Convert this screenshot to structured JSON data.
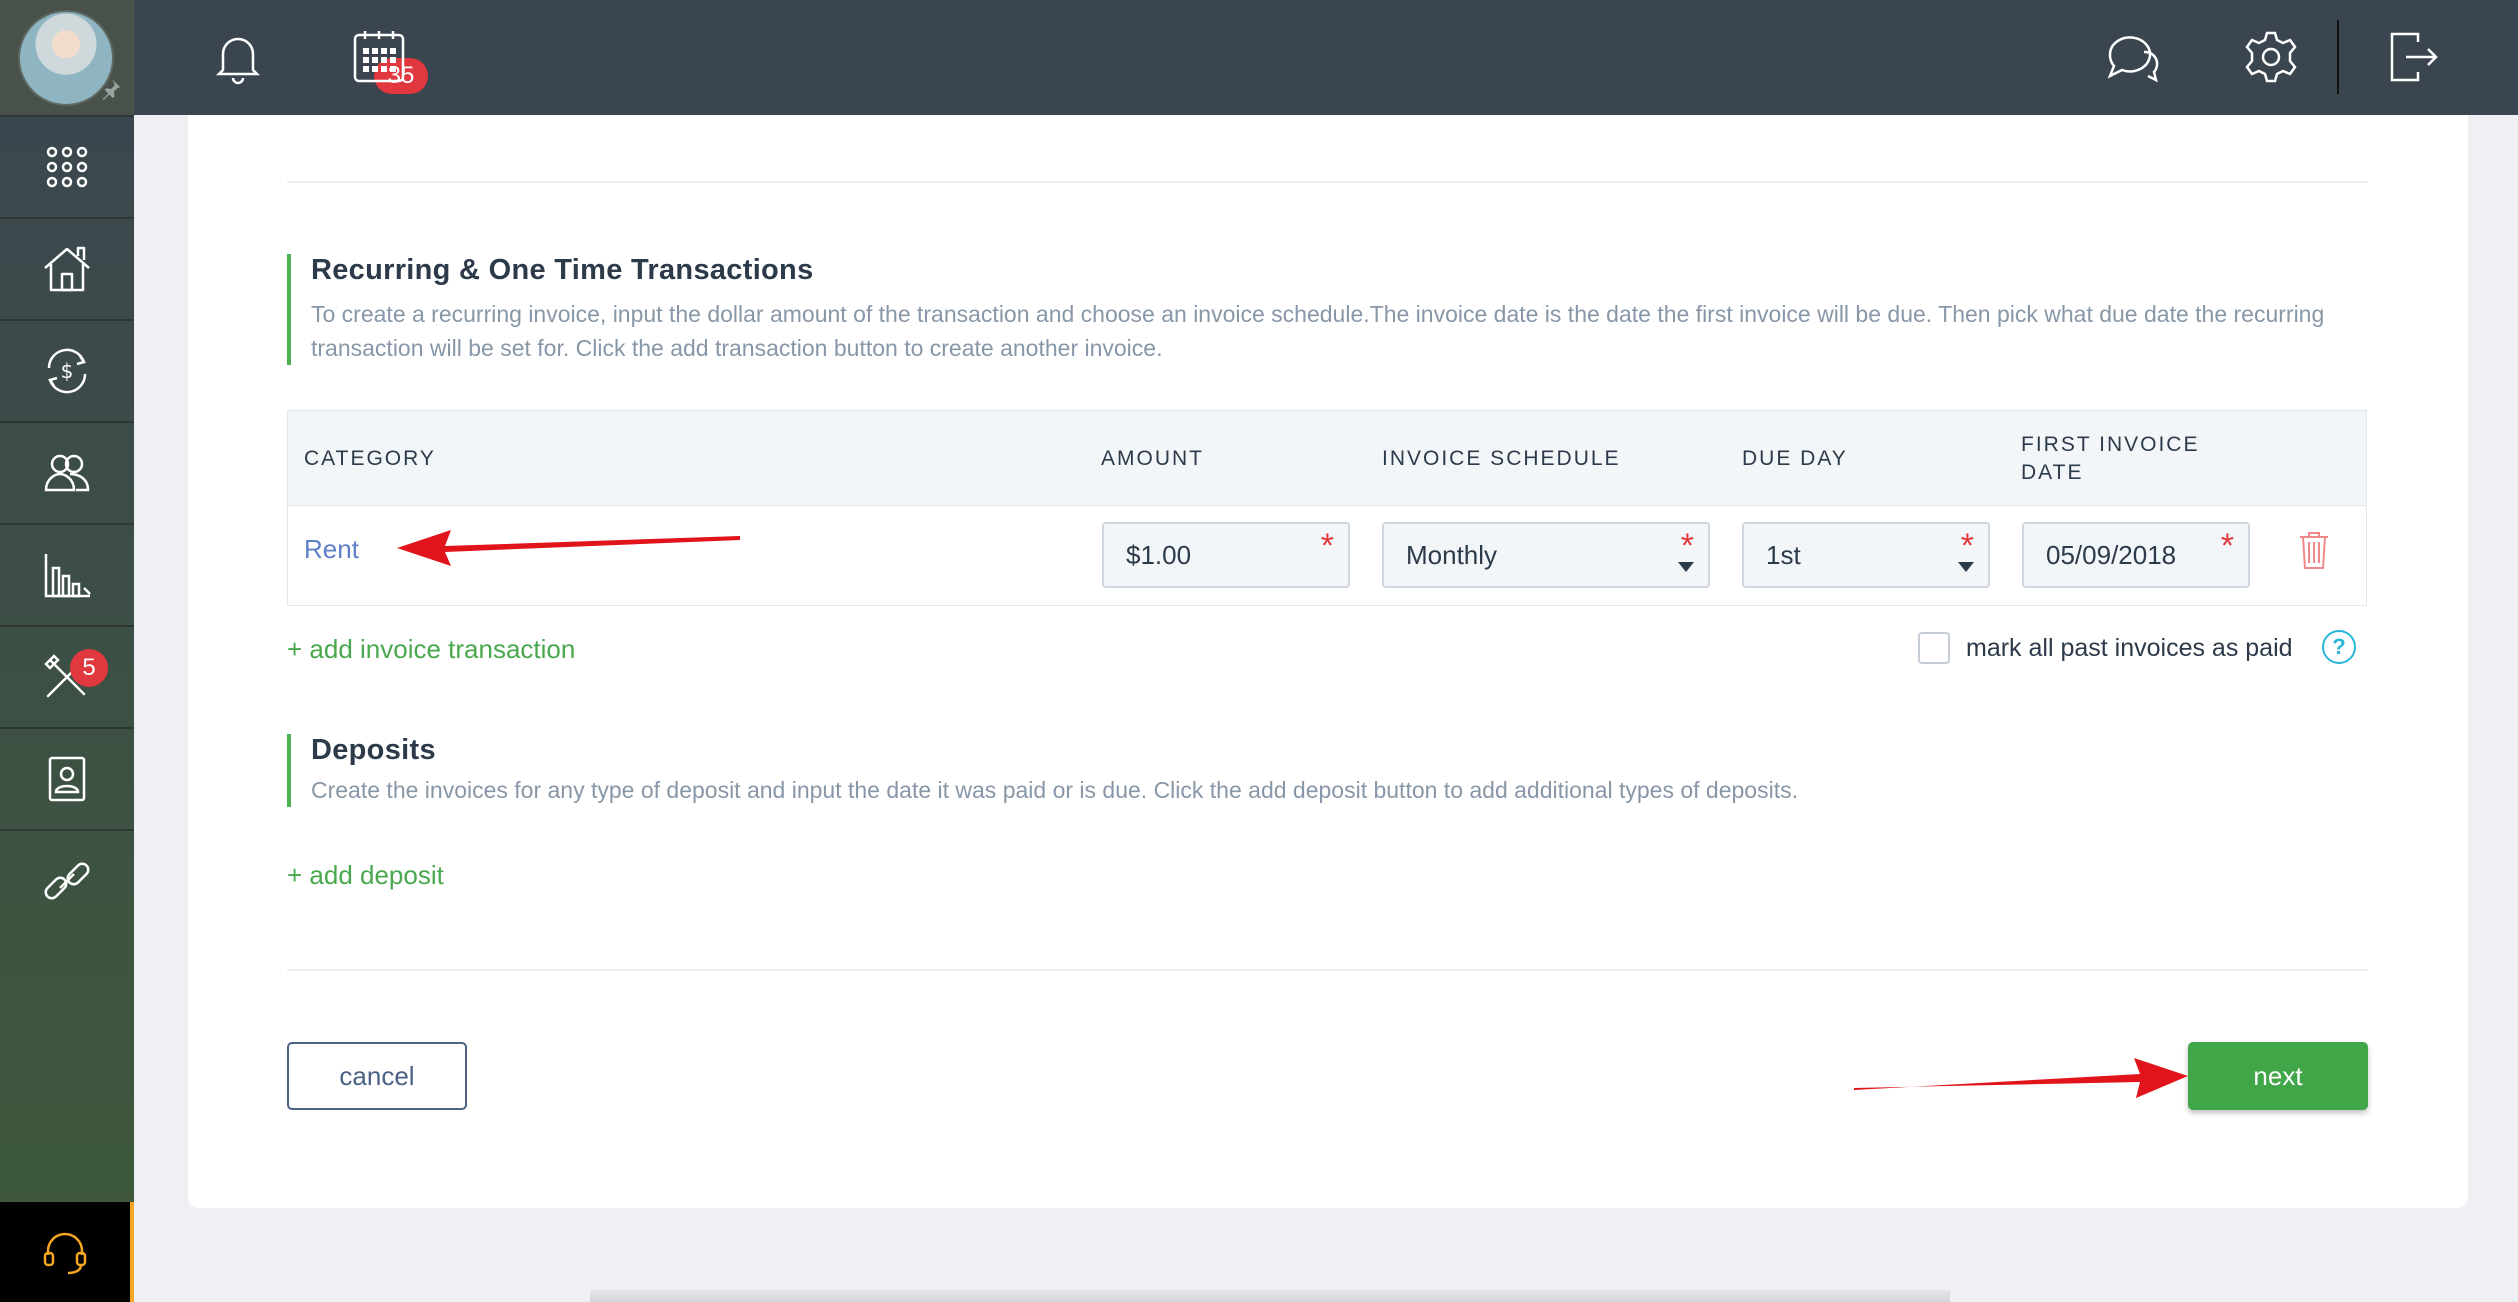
{
  "topbar": {
    "notification_count": "35"
  },
  "sidebar": {
    "tools_badge": "5"
  },
  "recurring": {
    "title": "Recurring & One Time Transactions",
    "description": "To create a recurring invoice, input the dollar amount of the transaction and choose an invoice schedule.The invoice date is the date the first invoice will be due. Then pick what due date the recurring transaction will be set for. Click the add transaction button to create another invoice."
  },
  "table": {
    "headers": {
      "category": "CATEGORY",
      "amount": "AMOUNT",
      "schedule": "INVOICE SCHEDULE",
      "due_day": "DUE DAY",
      "first_invoice_date_line1": "FIRST INVOICE",
      "first_invoice_date_line2": "DATE"
    },
    "rows": [
      {
        "category": "Rent",
        "amount": "$1.00",
        "schedule": "Monthly",
        "due_day": "1st",
        "first_invoice_date": "05/09/2018"
      }
    ],
    "required_mark": "*"
  },
  "add_invoice_transaction": "+ add invoice transaction",
  "mark_paid": {
    "label": "mark all past invoices as paid",
    "checked": false,
    "help": "?"
  },
  "deposits": {
    "title": "Deposits",
    "description": "Create the invoices for any type of deposit and input the date it was paid or is due. Click the add deposit button to add additional types of deposits.",
    "add_label": "+ add deposit"
  },
  "actions": {
    "cancel": "cancel",
    "next": "next"
  },
  "colors": {
    "accent_green": "#41a648",
    "topbar": "#3b4550",
    "badge_red": "#e0383e",
    "annotation_arrow": "#e0141a"
  }
}
